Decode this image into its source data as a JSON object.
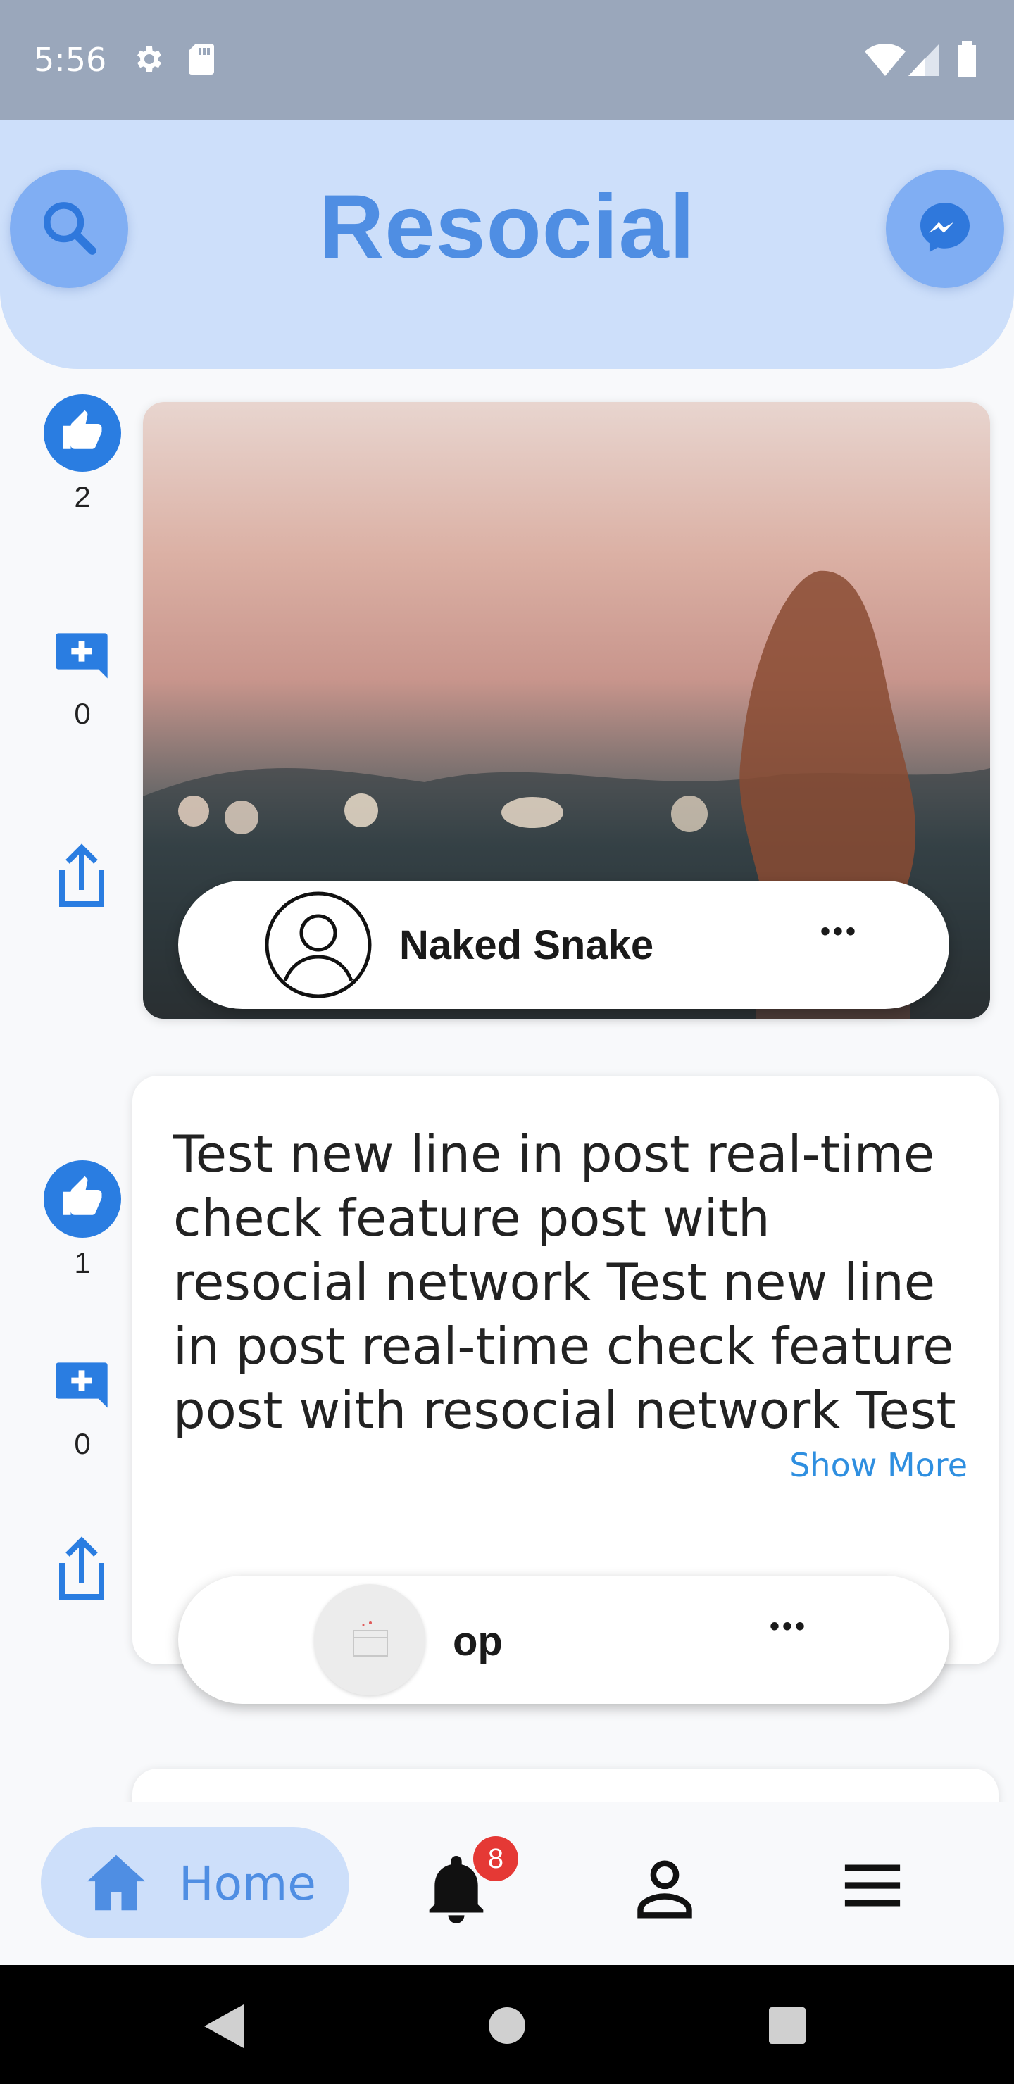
{
  "status_bar": {
    "time": "5:56",
    "icons_left": [
      "gear-icon",
      "sd-card-icon"
    ],
    "icons_right": [
      "wifi-icon",
      "signal-icon",
      "battery-icon"
    ]
  },
  "header": {
    "title": "Resocial",
    "left_button_icon": "search-icon",
    "right_button_icon": "messenger-icon"
  },
  "posts": [
    {
      "likes": "2",
      "comments": "0",
      "author": "Naked Snake",
      "has_image": true,
      "menu": "•••"
    },
    {
      "likes": "1",
      "comments": "0",
      "text": "Test new line in post real-time check feature post with resocial network Test new line in post real-time check feature post with resocial network Test new line in",
      "show_more": "Show More",
      "author": "op",
      "menu": "•••"
    }
  ],
  "bottom_nav": {
    "home_label": "Home",
    "notification_count": "8",
    "items": [
      "home-icon",
      "bell-icon",
      "profile-icon",
      "menu-icon"
    ]
  },
  "colors": {
    "accent": "#4f8ee3",
    "header_bg": "#cddffa",
    "like_blue": "#2a7de1",
    "badge_red": "#e53935"
  }
}
